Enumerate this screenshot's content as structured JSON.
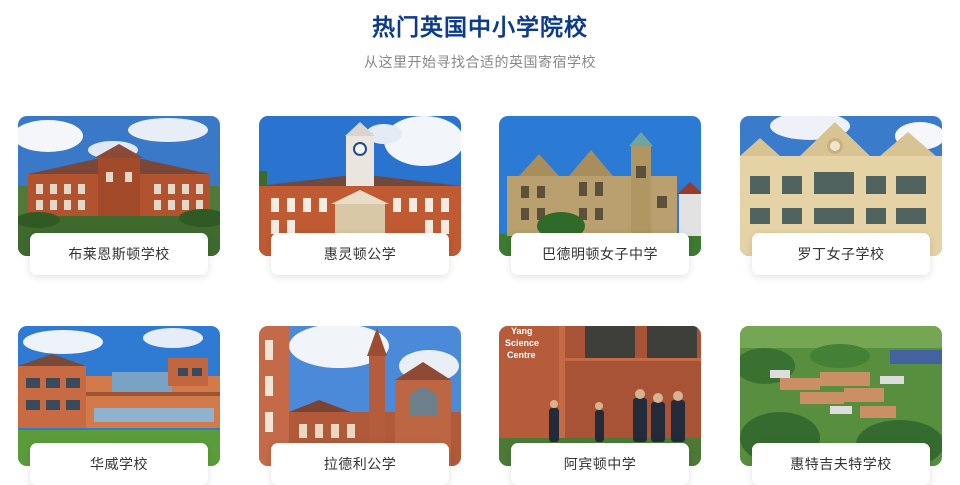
{
  "section": {
    "title": "热门英国中小学院校",
    "subtitle": "从这里开始寻找合适的英国寄宿学校"
  },
  "schools": [
    {
      "name": "布莱恩斯顿学校",
      "image": "red-brick-manor-photo"
    },
    {
      "name": "惠灵顿公学",
      "image": "clock-tower-hall-photo"
    },
    {
      "name": "巴德明顿女子中学",
      "image": "stone-gothic-house-photo"
    },
    {
      "name": "罗丁女子学校",
      "image": "cream-stone-gables-photo"
    },
    {
      "name": "华威学校",
      "image": "modern-brick-building-photo"
    },
    {
      "name": "拉德利公学",
      "image": "gothic-chapel-photo"
    },
    {
      "name": "阿宾顿中学",
      "image": "science-centre-students-photo"
    },
    {
      "name": "惠特吉夫特学校",
      "image": "campus-aerial-photo"
    }
  ],
  "photo_text": {
    "science_sign_line1": "Yang",
    "science_sign_line2": "Science",
    "science_sign_line3": "Centre"
  }
}
